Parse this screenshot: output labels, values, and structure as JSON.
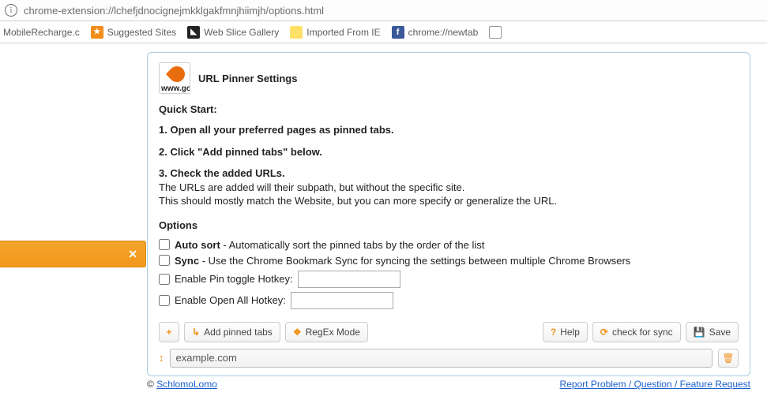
{
  "urlbar": {
    "url": "chrome-extension://lchefjdnocignejmkklgakfmnjhiimjh/options.html"
  },
  "bookmarks": {
    "items": [
      {
        "label": "MobileRecharge.c"
      },
      {
        "label": "Suggested Sites"
      },
      {
        "label": "Web Slice Gallery"
      },
      {
        "label": "Imported From IE"
      },
      {
        "label": "chrome://newtab"
      }
    ]
  },
  "header": {
    "logo_text": "www.go",
    "title": "URL Pinner Settings"
  },
  "quick_start": {
    "heading": "Quick Start:",
    "step1": "1. Open all your preferred pages as pinned tabs.",
    "step2": "2. Click \"Add pinned tabs\" below.",
    "step3": "3. Check the added URLs.",
    "step3_l2": "The URLs are added will their subpath, but without the specific site.",
    "step3_l3": "This should mostly match the Website, but you can more specify or generalize the URL."
  },
  "options": {
    "heading": "Options",
    "autosort_b": "Auto sort",
    "autosort_rest": " - Automatically sort the pinned tabs by the order of the list",
    "sync_b": "Sync",
    "sync_rest": " - Use the Chrome Bookmark Sync for syncing the settings between multiple Chrome Browsers",
    "pinhotkey_label": "Enable Pin toggle Hotkey:",
    "openhotkey_label": "Enable Open All Hotkey:",
    "pinhotkey_value": "",
    "openhotkey_value": ""
  },
  "toolbar": {
    "add_label": "Add pinned tabs",
    "regex_label": "RegEx Mode",
    "help_label": "Help",
    "check_label": "check for sync",
    "save_label": "Save"
  },
  "urls": {
    "items": [
      {
        "value": "example.com"
      }
    ]
  },
  "footer": {
    "copyright_prefix": "© ",
    "author": "SchlomoLomo",
    "report": "Report Problem / Question / Feature Request"
  }
}
